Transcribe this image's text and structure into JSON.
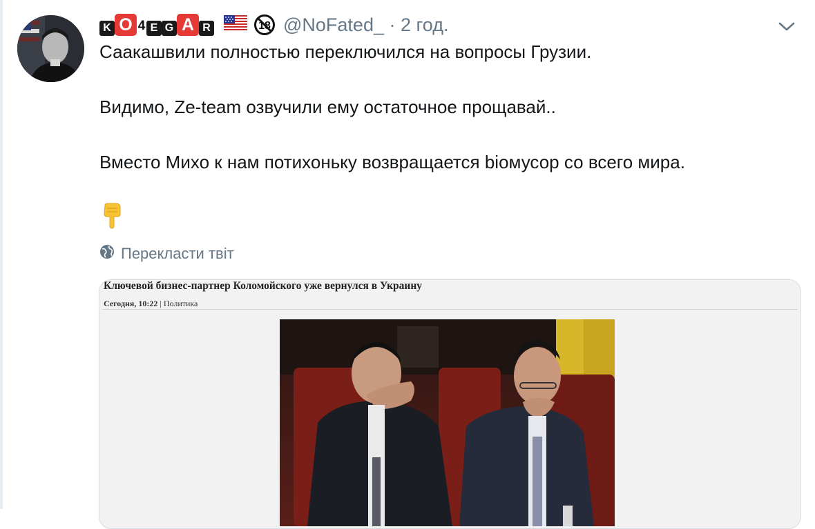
{
  "tweet": {
    "author": {
      "display_name_keys": [
        "K",
        "O",
        "4",
        "E",
        "G",
        "A",
        "R"
      ],
      "handle": "@NoFated_",
      "time": "· 2 год.",
      "age_badge": "18"
    },
    "lines": [
      "Саакашвили полностью переключился на вопросы Грузии.",
      "Видимо, Ze-team озвучили ему остаточное прощавай..",
      "Вместо Михо к нам потихоньку возвращается biомусор со всего мира."
    ],
    "emoji": "backhand-index-pointing-down",
    "translate_label": "Перекласти твіт"
  },
  "media": {
    "article_title": "Ключевой бизнес-партнер Коломойского уже вернулся в Украину",
    "article_date": "Сегодня, 10:22",
    "article_separator": "|",
    "article_category": "Политика"
  },
  "colors": {
    "text": "#14171a",
    "secondary": "#657786",
    "accent_red": "#e53935",
    "card_border": "#d7dde2"
  }
}
